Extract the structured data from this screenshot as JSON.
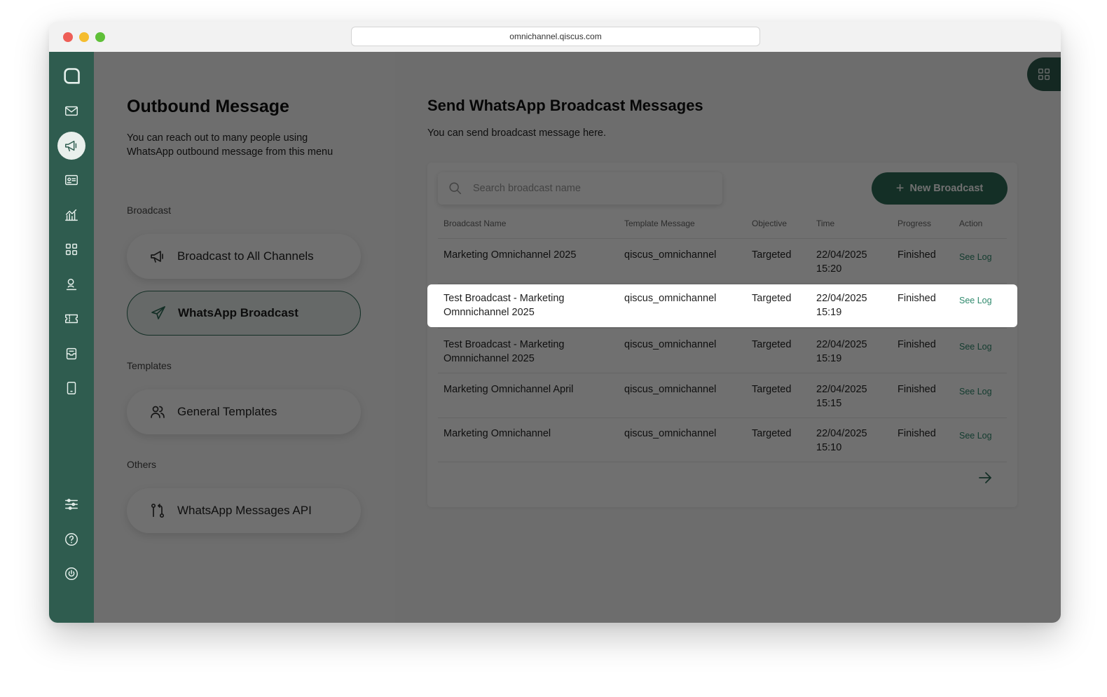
{
  "browser": {
    "url": "omnichannel.qiscus.com"
  },
  "left": {
    "title": "Outbound Message",
    "description": "You can reach out to many people using WhatsApp outbound message from this menu",
    "sections": {
      "broadcast": "Broadcast",
      "templates": "Templates",
      "others": "Others"
    },
    "items": {
      "broadcast_all": "Broadcast to All Channels",
      "whatsapp_broadcast": "WhatsApp Broadcast",
      "general_templates": "General Templates",
      "messages_api": "WhatsApp Messages API"
    }
  },
  "main": {
    "title": "Send WhatsApp Broadcast Messages",
    "description": "You can send broadcast message here.",
    "search_placeholder": "Search broadcast name",
    "new_button": "New Broadcast",
    "columns": {
      "name": "Broadcast Name",
      "template": "Template Message",
      "objective": "Objective",
      "time": "Time",
      "progress": "Progress",
      "action": "Action"
    },
    "rows": [
      {
        "name": "Marketing Omnichannel 2025",
        "template": "qiscus_omnichannel",
        "objective": "Targeted",
        "date": "22/04/2025",
        "clock": "15:20",
        "progress": "Finished",
        "action": "See Log"
      },
      {
        "name": "Test Broadcast - Marketing Omnnichannel 2025",
        "template": "qiscus_omnichannel",
        "objective": "Targeted",
        "date": "22/04/2025",
        "clock": "15:19",
        "progress": "Finished",
        "action": "See Log"
      },
      {
        "name": "Test Broadcast - Marketing Omnnichannel 2025",
        "template": "qiscus_omnichannel",
        "objective": "Targeted",
        "date": "22/04/2025",
        "clock": "15:19",
        "progress": "Finished",
        "action": "See Log"
      },
      {
        "name": "Marketing Omnichannel April",
        "template": "qiscus_omnichannel",
        "objective": "Targeted",
        "date": "22/04/2025",
        "clock": "15:15",
        "progress": "Finished",
        "action": "See Log"
      },
      {
        "name": "Marketing Omnichannel",
        "template": "qiscus_omnichannel",
        "objective": "Targeted",
        "date": "22/04/2025",
        "clock": "15:10",
        "progress": "Finished",
        "action": "See Log"
      }
    ]
  },
  "highlighted_row_index": 1,
  "colors": {
    "brand": "#2f5c4f",
    "accent": "#2f6b58",
    "link": "#2f8a6d"
  },
  "icons": {
    "rail": [
      "chat-logo-icon",
      "mail-icon",
      "megaphone-icon",
      "contact-card-icon",
      "analytics-icon",
      "apps-grid-icon",
      "agent-icon",
      "ticket-icon",
      "inbox-icon",
      "mobile-icon",
      "settings-sliders-icon",
      "help-icon",
      "power-icon"
    ],
    "top_right": "apps-grid-icon"
  }
}
